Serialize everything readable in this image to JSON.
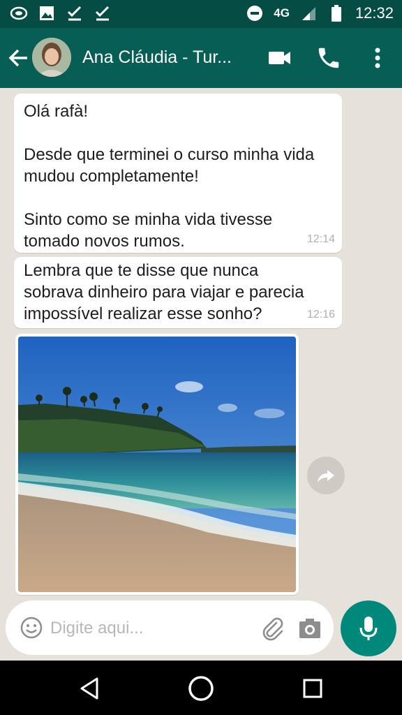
{
  "status_bar": {
    "network": "4G",
    "time": "12:32",
    "icons": [
      "whatsapp-icon",
      "image-icon",
      "check-icon",
      "check-icon",
      "do-not-disturb-icon",
      "signal-icon",
      "battery-icon"
    ]
  },
  "header": {
    "contact_name": "Ana Cláudia - Tur...",
    "icons": [
      "back-arrow-icon",
      "video-call-icon",
      "phone-icon",
      "more-vert-icon"
    ]
  },
  "messages": [
    {
      "text": "Olá rafà!\n\nDesde que terminei o curso minha vida\nmudou completamente!\n\nSinto como se minha vida tivesse\ntomado novos rumos.",
      "time": "12:14"
    },
    {
      "text": "Lembra que te disse que nunca\nsobrava dinheiro para viajar e parecia\nimpossível realizar esse sonho?",
      "time": "12:16"
    }
  ],
  "input": {
    "placeholder": "Digite aqui...",
    "value": ""
  },
  "colors": {
    "header": "#075e54",
    "status_bar": "#054d44",
    "chat_background": "#e6e1da",
    "mic_button": "#00897b"
  }
}
